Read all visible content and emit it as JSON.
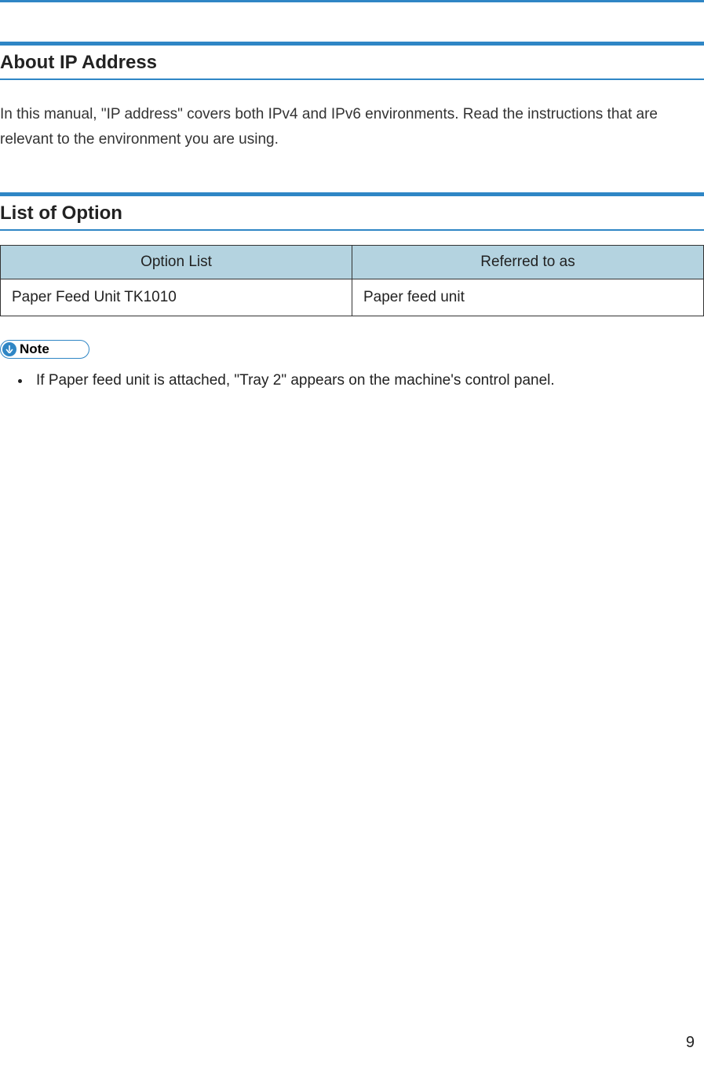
{
  "sections": {
    "ip": {
      "title": "About IP Address",
      "body": "In this manual, \"IP address\" covers both IPv4 and IPv6 environments. Read the instructions that are relevant to the environment you are using."
    },
    "option": {
      "title": "List of Option",
      "table": {
        "headers": [
          "Option List",
          "Referred to as"
        ],
        "rows": [
          [
            "Paper Feed Unit TK1010",
            "Paper feed unit"
          ]
        ]
      },
      "note_label": "Note",
      "notes": [
        "If Paper feed unit is attached, \"Tray 2\" appears on the machine's control panel."
      ]
    }
  },
  "page_number": "9"
}
